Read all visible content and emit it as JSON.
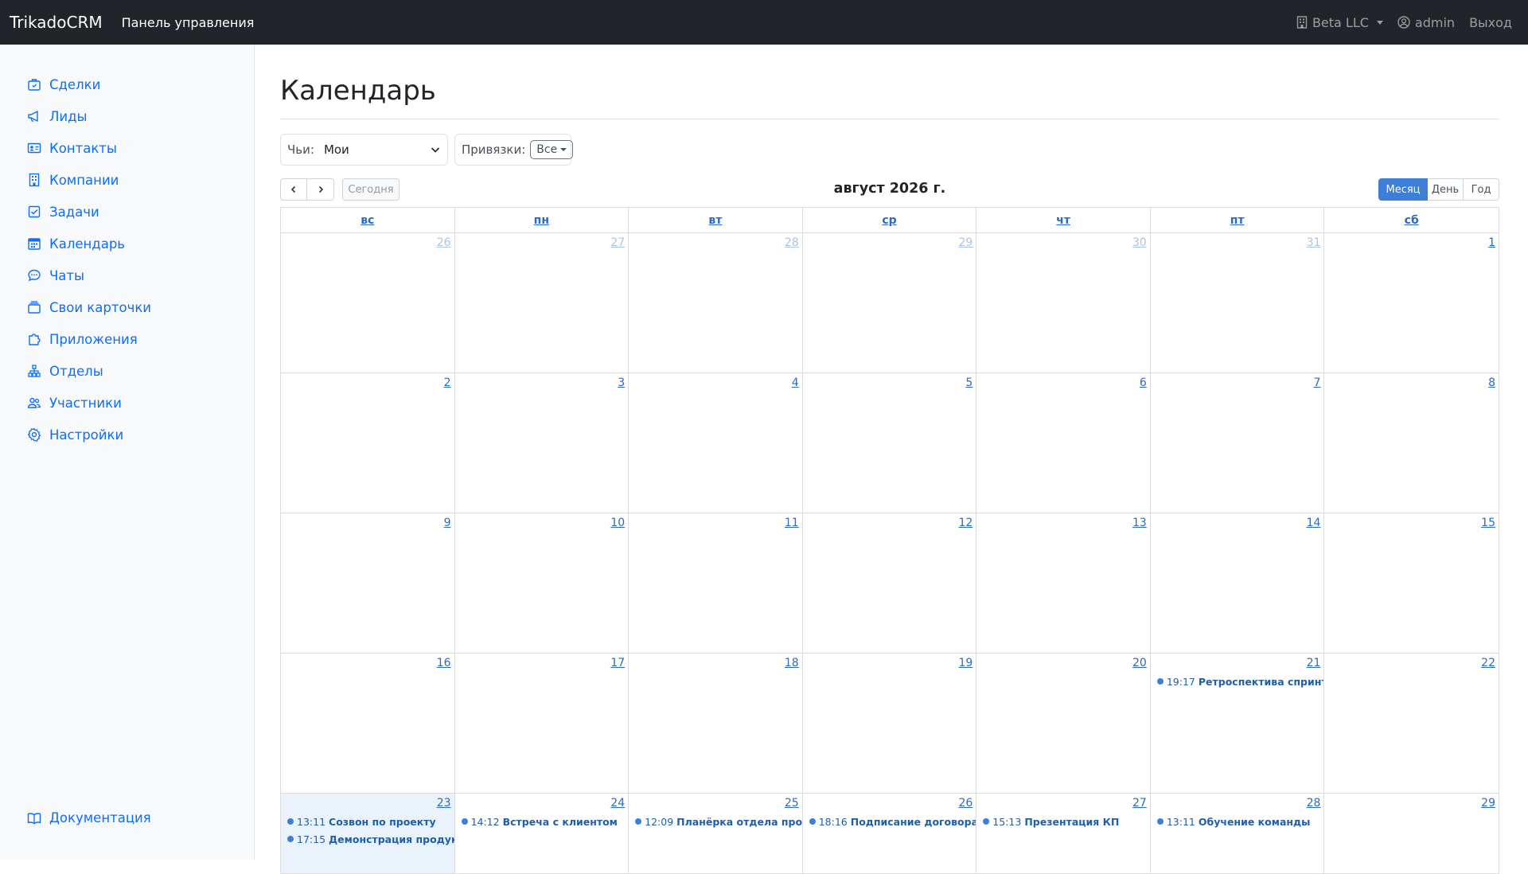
{
  "navbar": {
    "brand": "TrikadoCRM",
    "dashboard_link": "Панель управления",
    "company": "Beta LLC",
    "user": "admin",
    "logout": "Выход"
  },
  "sidebar": {
    "items": [
      {
        "label": "Сделки",
        "icon": "briefcase-icon"
      },
      {
        "label": "Лиды",
        "icon": "megaphone-icon"
      },
      {
        "label": "Контакты",
        "icon": "id-card-icon"
      },
      {
        "label": "Компании",
        "icon": "building-icon"
      },
      {
        "label": "Задачи",
        "icon": "check-square-icon"
      },
      {
        "label": "Календарь",
        "icon": "calendar-icon"
      },
      {
        "label": "Чаты",
        "icon": "chat-icon"
      },
      {
        "label": "Свои карточки",
        "icon": "cards-icon"
      },
      {
        "label": "Приложения",
        "icon": "puzzle-icon"
      },
      {
        "label": "Отделы",
        "icon": "org-chart-icon"
      },
      {
        "label": "Участники",
        "icon": "people-icon"
      },
      {
        "label": "Настройки",
        "icon": "gear-icon"
      }
    ],
    "documentation": "Документация"
  },
  "page": {
    "title": "Календарь"
  },
  "filters": {
    "owner_label": "Чьи:",
    "owner_value": "Мои",
    "binding_label": "Привязки:",
    "binding_value": "Все"
  },
  "toolbar": {
    "today": "Сегодня",
    "title": "август 2026 г.",
    "views": {
      "month": "Месяц",
      "day": "День",
      "year": "Год"
    },
    "active_view": "month"
  },
  "calendar": {
    "weekdays": [
      "вс",
      "пн",
      "вт",
      "ср",
      "чт",
      "пт",
      "сб"
    ],
    "weeks": [
      [
        {
          "n": "26",
          "other": true
        },
        {
          "n": "27",
          "other": true
        },
        {
          "n": "28",
          "other": true
        },
        {
          "n": "29",
          "other": true
        },
        {
          "n": "30",
          "other": true
        },
        {
          "n": "31",
          "other": true
        },
        {
          "n": "1"
        }
      ],
      [
        {
          "n": "2"
        },
        {
          "n": "3"
        },
        {
          "n": "4"
        },
        {
          "n": "5"
        },
        {
          "n": "6"
        },
        {
          "n": "7"
        },
        {
          "n": "8"
        }
      ],
      [
        {
          "n": "9"
        },
        {
          "n": "10"
        },
        {
          "n": "11"
        },
        {
          "n": "12"
        },
        {
          "n": "13"
        },
        {
          "n": "14"
        },
        {
          "n": "15"
        }
      ],
      [
        {
          "n": "16"
        },
        {
          "n": "17"
        },
        {
          "n": "18"
        },
        {
          "n": "19"
        },
        {
          "n": "20"
        },
        {
          "n": "21",
          "events": [
            {
              "time": "19:17",
              "title": "Ретроспектива спринта"
            }
          ]
        },
        {
          "n": "22"
        }
      ],
      [
        {
          "n": "23",
          "today": true,
          "events": [
            {
              "time": "13:11",
              "title": "Созвон по проекту"
            },
            {
              "time": "17:15",
              "title": "Демонстрация продукта"
            }
          ]
        },
        {
          "n": "24",
          "events": [
            {
              "time": "14:12",
              "title": "Встреча с клиентом"
            }
          ]
        },
        {
          "n": "25",
          "events": [
            {
              "time": "12:09",
              "title": "Планёрка отдела продаж"
            }
          ]
        },
        {
          "n": "26",
          "events": [
            {
              "time": "18:16",
              "title": "Подписание договора"
            }
          ]
        },
        {
          "n": "27",
          "events": [
            {
              "time": "15:13",
              "title": "Презентация КП"
            }
          ]
        },
        {
          "n": "28",
          "events": [
            {
              "time": "13:11",
              "title": "Обучение команды"
            }
          ]
        },
        {
          "n": "29"
        }
      ]
    ]
  }
}
